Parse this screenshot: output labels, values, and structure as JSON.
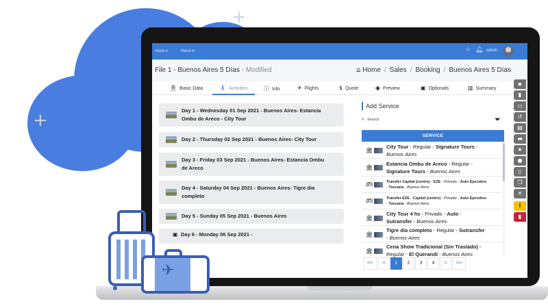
{
  "nav": {
    "menu_items": [
      "Inicio",
      "Menú"
    ],
    "user_label": "admin"
  },
  "header": {
    "file_title": "File 1 - Buenos Aires 5 Días",
    "status": "- Modified",
    "breadcrumb": [
      "Home",
      "Sales",
      "Booking",
      "Buenos Aires 5 Días"
    ]
  },
  "tabs": [
    {
      "label": "Basic Data",
      "icon": "clipboard-icon"
    },
    {
      "label": "Activities",
      "icon": "walk-icon"
    },
    {
      "label": "Info",
      "icon": "info-icon"
    },
    {
      "label": "Flights",
      "icon": "plane-icon"
    },
    {
      "label": "Quote",
      "icon": "dollar-icon"
    },
    {
      "label": "Preview",
      "icon": "eye-icon"
    },
    {
      "label": "Optionals",
      "icon": "image-icon"
    },
    {
      "label": "Summary",
      "icon": "chart-icon"
    }
  ],
  "days": [
    {
      "line1": "Day 1 - Wednesday 01 Sep 2021 - Buenos Aires- Estancia",
      "line2": "Ombu de Areco - City Tour"
    },
    {
      "line1": "Day 2 - Thursday 02 Sep 2021 - Buenos Aires- City Tour",
      "line2": ""
    },
    {
      "line1": "Day 3 - Friday 03 Sep 2021 - Buenos Aires- Estancia Ombu",
      "line2": "de Areco"
    },
    {
      "line1": "Day 4 - Saturday 04 Sep 2021 - Buenos Aires- Tigre dia",
      "line2": "completo"
    },
    {
      "line1": "Day 5 - Sunday 05 Sep 2021 - Buenos Aires",
      "line2": ""
    },
    {
      "line1": "Day 6 - Monday 06 Sep 2021 -",
      "line2": ""
    }
  ],
  "panel": {
    "title": "Add Service",
    "search_label": "Search",
    "table_header": "SERVICE"
  },
  "services": [
    {
      "name": "City Tour",
      "regime": "Regular",
      "provider": "Signature Tours",
      "city": "Buenos Aires",
      "icon": "bank-icon"
    },
    {
      "name": "Estancia Ombu de Areco",
      "regime": "Regular",
      "provider": "Signature Tours",
      "city": "Buenos Aires",
      "icon": "bank-icon"
    },
    {
      "name": "Transfer Capital (centro) - EZE",
      "regime": "Privado",
      "provider": "Auto Ejecutivo",
      "extra": "Toscana",
      "city": "Buenos Aires",
      "icon": "bus-icon"
    },
    {
      "name": "Transfer EZE - Capital (centro)",
      "regime": "Privado",
      "provider": "Auto Ejecutivo",
      "extra": "Toscana",
      "city": "Buenos Aires",
      "icon": "bus-icon"
    },
    {
      "name": "City Tour 4 hs",
      "regime": "Privado",
      "provider": "Auto",
      "extra": "Sutransfer",
      "city": "Buenos Aires",
      "icon": "bank-icon"
    },
    {
      "name": "Tigre dia completo",
      "regime": "Regular",
      "provider": "Sutransfer",
      "city": "Buenos Aires",
      "icon": "bank-icon"
    },
    {
      "name": "Cena Show Tradicional (Sin Traslado)",
      "regime": "Regular",
      "provider": "El Querandi",
      "city": "Buenos Aires",
      "icon": "bank-icon"
    }
  ],
  "pagination": {
    "first": "<<",
    "prev": "<",
    "pages": [
      "1",
      "2",
      "3",
      "4"
    ],
    "current": "1",
    "next": ">",
    "last": ">>"
  },
  "tool_icons": [
    "save-icon",
    "trash-icon",
    "inbox-icon",
    "history-icon",
    "clipboard-check-icon",
    "comment-icon",
    "star-icon",
    "users-icon",
    "document-icon",
    "copy-icon",
    "close-box-icon",
    "alert-icon",
    "delete-icon"
  ],
  "colors": {
    "primary": "#3a7bd5",
    "cloud": "#4a7de0",
    "luggage": "#3a5fb0",
    "warning": "#f0c20a",
    "danger": "#c8203d"
  }
}
